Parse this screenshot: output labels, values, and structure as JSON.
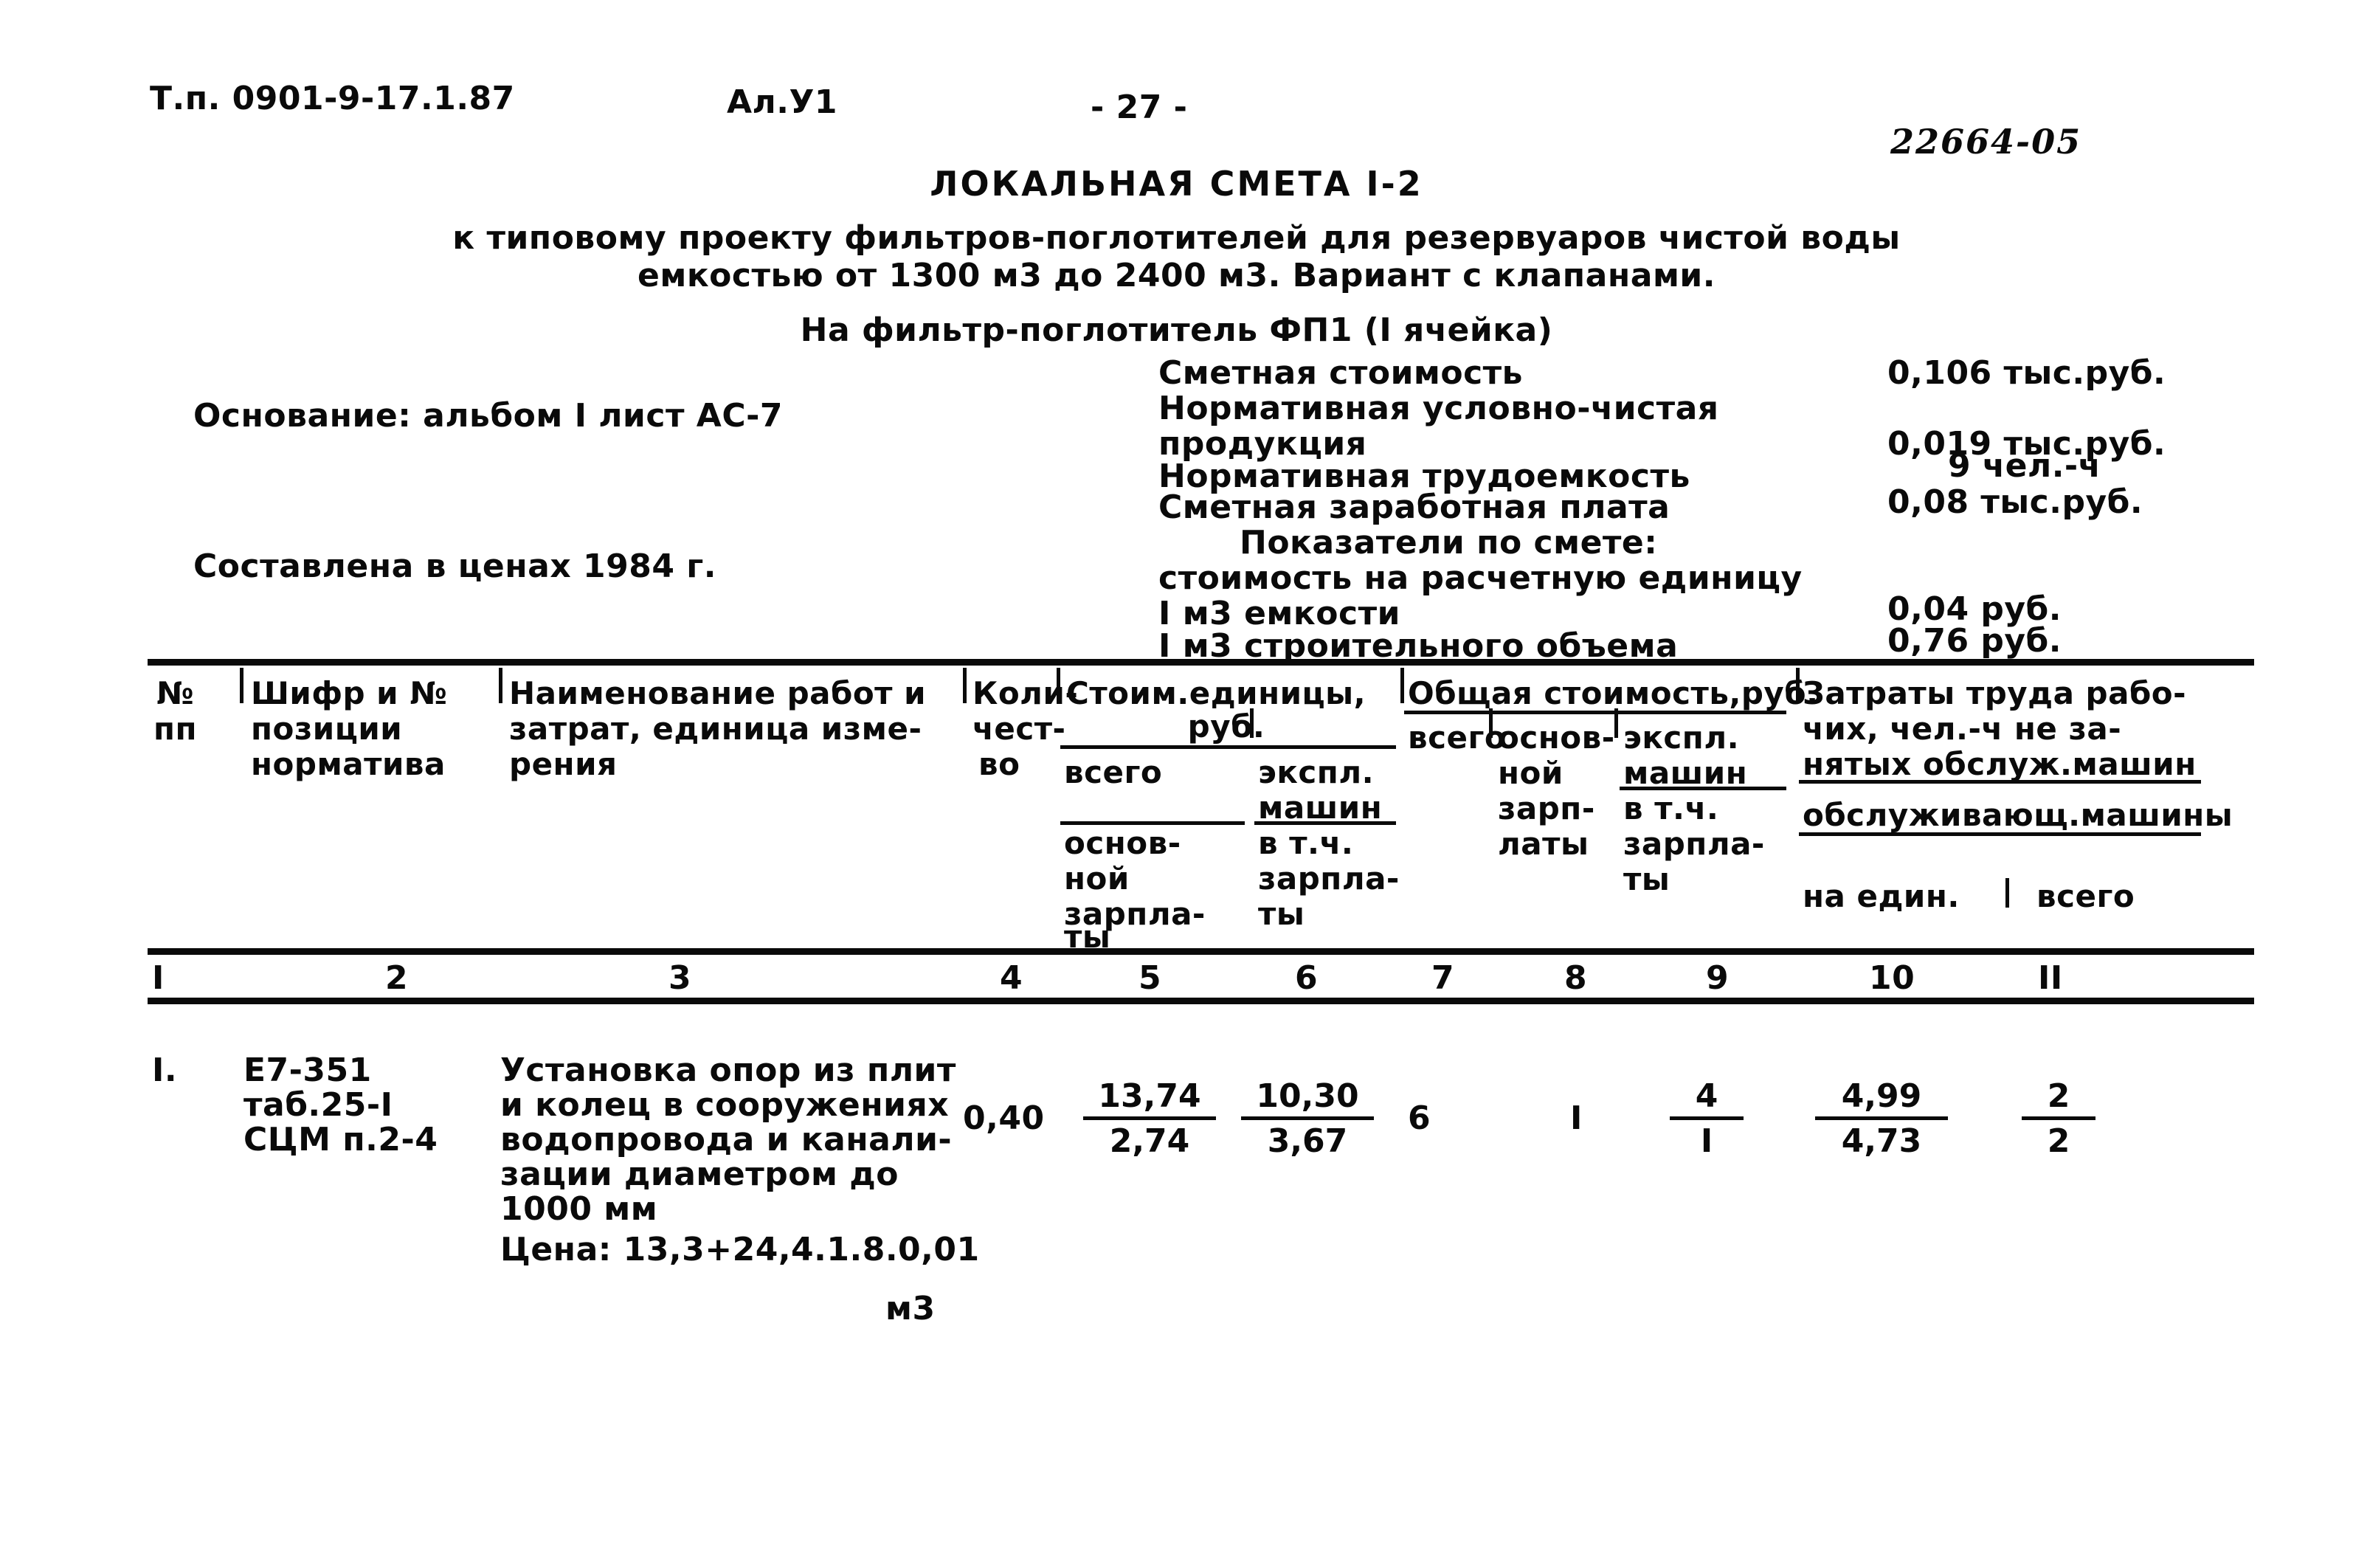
{
  "header": {
    "project_code": "Т.п. 0901-9-17.1.87",
    "album": "Ал.У1",
    "page_number": "- 27 -",
    "stamp": "22664-05"
  },
  "title": {
    "main": "ЛОКАЛЬНАЯ СМЕТА I-2",
    "subtitle_line1": "к типовому проекту фильтров-поглотителей для резервуаров чистой воды",
    "subtitle_line2": "емкостью от 1300 м3 до 2400 м3. Вариант с клапанами.",
    "object_line": "На фильтр-поглотитель ФП1 (I ячейка)"
  },
  "basis": {
    "basis_label": "Основание: альбом I лист АС-7",
    "prices_label": "Составлена в ценах 1984 г."
  },
  "summary": {
    "rows": [
      {
        "label": "Сметная стоимость",
        "value": "0,106 тыс.руб."
      },
      {
        "label": "Нормативная условно-чистая",
        "value": ""
      },
      {
        "label": "продукция",
        "value": "0,019 тыс.руб."
      },
      {
        "label": "Нормативная трудоемкость",
        "value": "9 чел.-ч"
      },
      {
        "label": "Сметная заработная плата",
        "value": "0,08 тыс.руб."
      }
    ],
    "indicators_header": "Показатели по смете:",
    "indicators_intro": "стоимость на расчетную единицу",
    "indicators": [
      {
        "label": "I м3 емкости",
        "value": "0,04 руб."
      },
      {
        "label": "I м3 строительного объема",
        "value": "0,76 руб."
      }
    ]
  },
  "table": {
    "headers": {
      "col1_line1": "№",
      "col1_line2": "пп",
      "col2_line1": "Шифр и №",
      "col2_line2": "позиции",
      "col2_line3": "норматива",
      "col3_line1": "Наименование работ и",
      "col3_line2": "затрат, единица изме-",
      "col3_line3": "рения",
      "col4_line1": "Коли-",
      "col4_line2": "чест-",
      "col4_line3": "во",
      "col5_group": "Стоим.единицы,",
      "col5_group2": "руб.",
      "col5_sub1_a": "всего",
      "col5_sub1_b1": "основ-",
      "col5_sub1_b2": "ной",
      "col5_sub1_b3": "зарпла-",
      "col5_sub1_b4": "ты",
      "col5_sub2_a1": "экспл.",
      "col5_sub2_a2": "машин",
      "col5_sub2_b1": "в т.ч.",
      "col5_sub2_b2": "зарпла-",
      "col5_sub2_b3": "ты",
      "col7_group": "Общая стоимость,руб.",
      "col7_sub1": "всего",
      "col8_sub1": "основ-",
      "col8_sub2": "ной",
      "col8_sub3": "зарп-",
      "col8_sub4": "латы",
      "col9_sub1": "экспл.",
      "col9_sub2": "машин",
      "col9_sub3": "в т.ч.",
      "col9_sub4": "зарпла-",
      "col9_sub5": "ты",
      "col10_group1": "Затраты труда рабо-",
      "col10_group2": "чих, чел.-ч не за-",
      "col10_group3": "нятых обслуж.машин",
      "col10_group4": "обслуживающ.машины",
      "col10_sub_a": "на един.",
      "col10_sub_b": "всего"
    },
    "column_numbers": [
      "I",
      "2",
      "3",
      "4",
      "5",
      "6",
      "7",
      "8",
      "9",
      "10",
      "II"
    ],
    "rows": [
      {
        "num": "I.",
        "code_line1": "Е7-351",
        "code_line2": "таб.25-I",
        "code_line3": "СЦМ п.2-4",
        "desc_line1": "Установка опор из плит",
        "desc_line2": "и колец в сооружениях",
        "desc_line3": "водопровода и канали-",
        "desc_line4": "зации диаметром до",
        "desc_line5": "1000 мм",
        "desc_line6": "Цена: 13,3+24,4.1.8.0,01",
        "unit": "м3",
        "qty": "0,40",
        "c5_num": "13,74",
        "c5_den": "2,74",
        "c6_num": "10,30",
        "c6_den": "3,67",
        "c7": "6",
        "c8": "I",
        "c9_num": "4",
        "c9_den": "I",
        "c10_num": "4,99",
        "c10_den": "4,73",
        "c11_num": "2",
        "c11_den": "2"
      }
    ]
  }
}
